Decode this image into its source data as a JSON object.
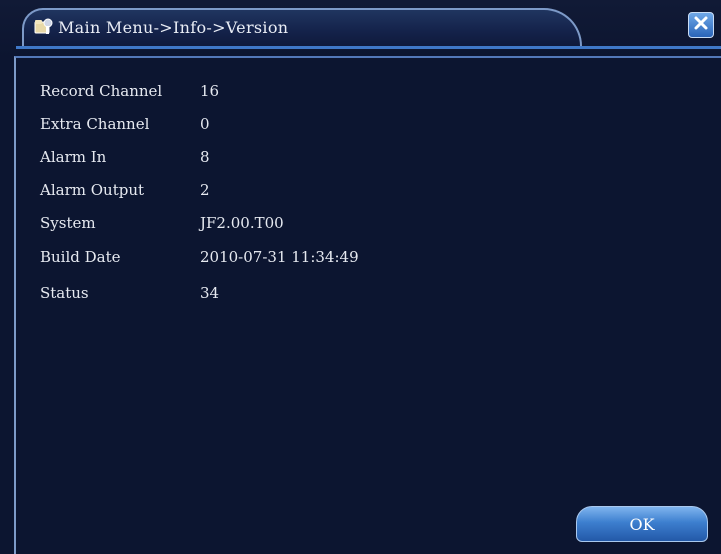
{
  "window": {
    "title": "Main Menu->Info->Version"
  },
  "info": {
    "rows": [
      {
        "label": "Record Channel",
        "value": "16"
      },
      {
        "label": "Extra Channel",
        "value": "0"
      },
      {
        "label": "Alarm In",
        "value": "8"
      },
      {
        "label": "Alarm Output",
        "value": "2"
      },
      {
        "label": "System",
        "value": "JF2.00.T00"
      },
      {
        "label": "Build Date",
        "value": "2010-07-31 11:34:49"
      },
      {
        "label": "Status",
        "value": "34"
      }
    ]
  },
  "footer": {
    "ok_label": "OK"
  },
  "colors": {
    "background": "#0c1530",
    "accent": "#3f78c8",
    "button": "#3d7fcf"
  },
  "icons": {
    "title_icon": "folder-tools-icon",
    "close_icon": "close-icon"
  }
}
